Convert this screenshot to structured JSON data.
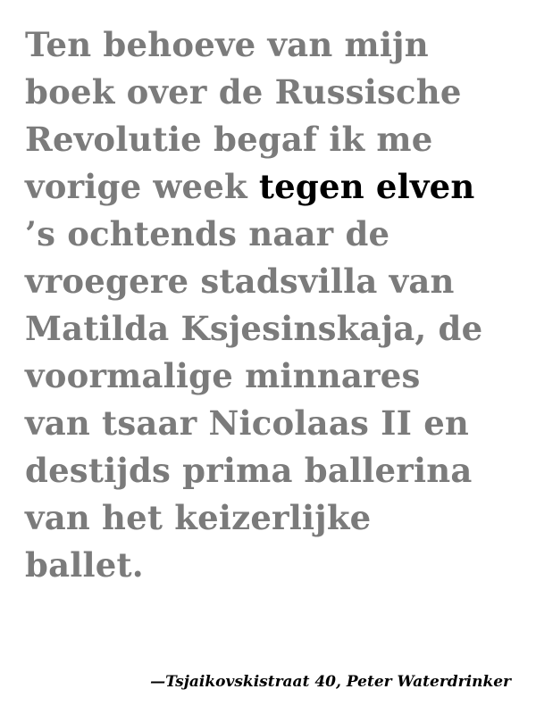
{
  "quote": {
    "lines": [
      "Ten behoeve van mijn",
      "boek over de Russische",
      "Revolutie begaf ik me",
      "vorige week ",
      "’s ochtends naar de",
      "vroegere stadsvilla van",
      "Matilda Ksjesinskaja, de",
      "voormalige minnares",
      "van tsaar Nicolaas II en",
      "destijds prima ballerina",
      "van het keizerlijke",
      "ballet."
    ],
    "highlight": "tegen elven"
  },
  "attribution": "—Tsjaikovskistraat 40, Peter Waterdrinker",
  "colors": {
    "muted_text": "#7b7b7b",
    "emphasis_text": "#000000",
    "background": "#ffffff"
  }
}
